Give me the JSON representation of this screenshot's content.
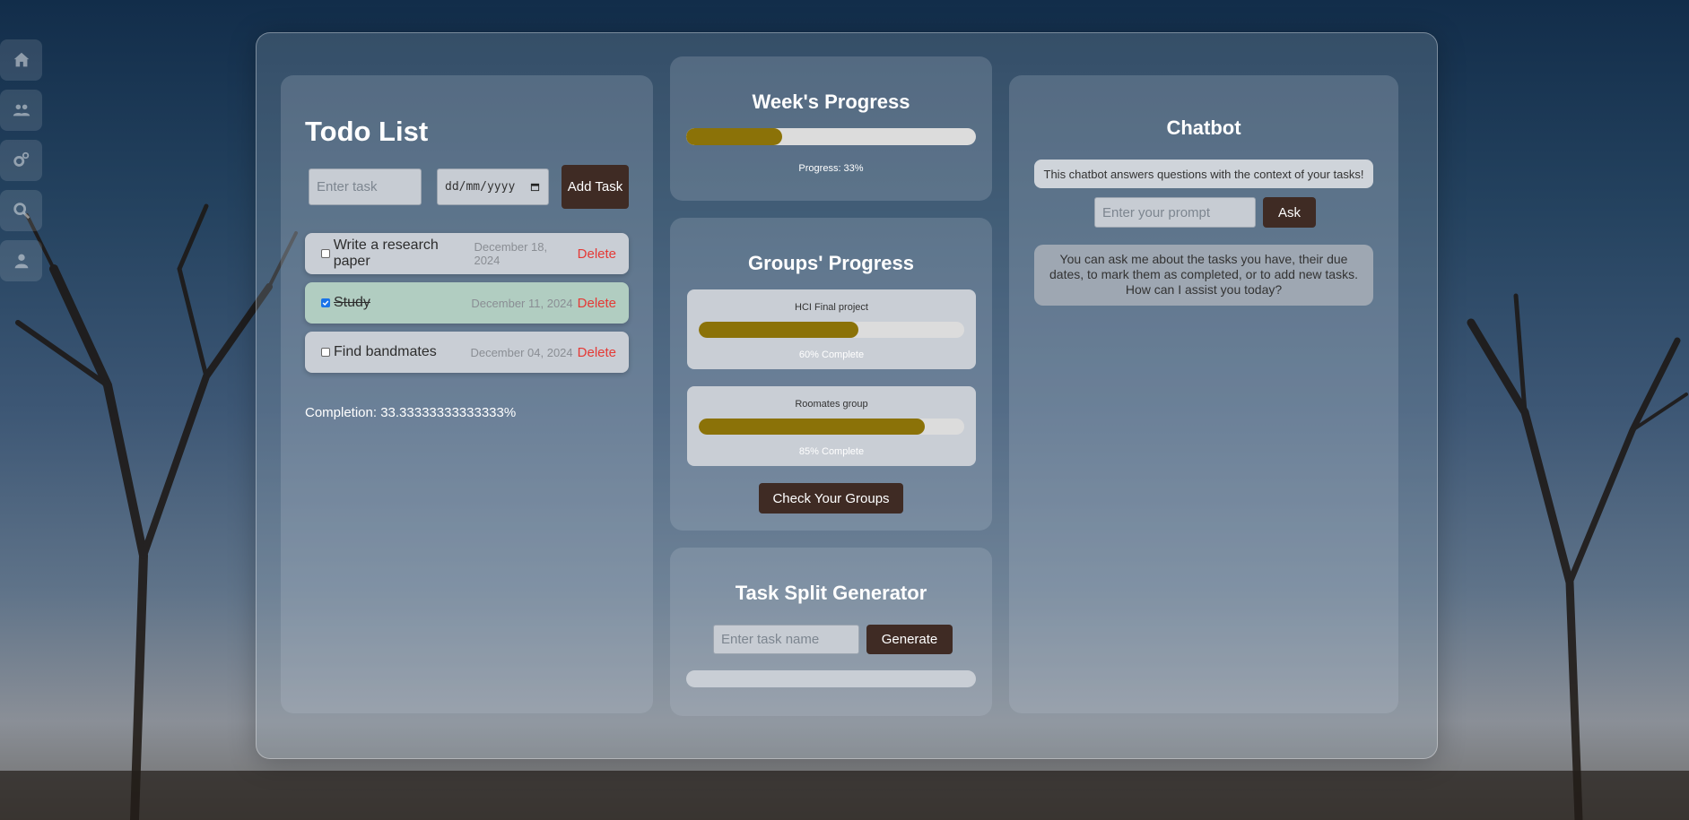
{
  "sidebar": {
    "items": [
      {
        "icon": "home-icon"
      },
      {
        "icon": "users-icon"
      },
      {
        "icon": "gears-icon"
      },
      {
        "icon": "search-icon"
      },
      {
        "icon": "user-icon"
      }
    ]
  },
  "todo": {
    "title": "Todo List",
    "task_placeholder": "Enter task",
    "date_placeholder": "dd/mm/yyyy",
    "add_label": "Add Task",
    "tasks": [
      {
        "name": "Write a research paper",
        "date": "December 18, 2024",
        "delete": "Delete",
        "checked": false
      },
      {
        "name": "Study",
        "date": "December 11, 2024",
        "delete": "Delete",
        "checked": true
      },
      {
        "name": "Find bandmates",
        "date": "December 04, 2024",
        "delete": "Delete",
        "checked": false
      }
    ],
    "completion": "Completion: 33.33333333333333%"
  },
  "week": {
    "title": "Week's Progress",
    "progress": 33,
    "label": "Progress: 33%"
  },
  "groups": {
    "title": "Groups' Progress",
    "items": [
      {
        "name": "HCI Final project",
        "progress": 60,
        "label": "60% Complete"
      },
      {
        "name": "Roomates group",
        "progress": 85,
        "label": "85% Complete"
      }
    ],
    "button": "Check Your Groups"
  },
  "split": {
    "title": "Task Split Generator",
    "placeholder": "Enter task name",
    "button": "Generate",
    "progress": 0
  },
  "chat": {
    "title": "Chatbot",
    "info": "This chatbot answers questions with the context of your tasks!",
    "placeholder": "Enter your prompt",
    "button": "Ask",
    "message": "You can ask me about the tasks you have, their due dates, to mark them as completed, or to add new tasks. How can I assist you today?"
  },
  "colors": {
    "accent_button": "#3f2b24",
    "progress_fill": "#8b7208",
    "delete": "#e53935"
  }
}
